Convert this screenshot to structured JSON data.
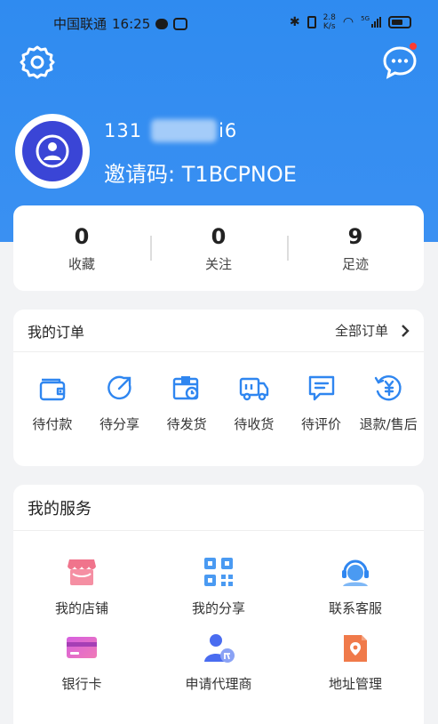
{
  "status_bar": {
    "carrier": "中国联通",
    "time": "16:25",
    "net_speed_value": "2.8",
    "net_speed_unit": "K/s",
    "signal_badge": "5G"
  },
  "header": {
    "settings_icon": "gear-icon",
    "messages_icon": "chat-bubble-icon",
    "notification_dot_color": "#ff3b30"
  },
  "profile": {
    "phone_prefix": "131",
    "phone_suffix": "i6",
    "invite_label": "邀请码: T1BCPNOE",
    "avatar_icon": "user-icon"
  },
  "stats": [
    {
      "value": "0",
      "label": "收藏"
    },
    {
      "value": "0",
      "label": "关注"
    },
    {
      "value": "9",
      "label": "足迹"
    }
  ],
  "orders": {
    "title": "我的订单",
    "all_label": "全部订单",
    "items": [
      {
        "label": "待付款",
        "icon": "wallet-icon"
      },
      {
        "label": "待分享",
        "icon": "share-arrow-icon"
      },
      {
        "label": "待发货",
        "icon": "package-clock-icon"
      },
      {
        "label": "待收货",
        "icon": "truck-icon"
      },
      {
        "label": "待评价",
        "icon": "comment-icon"
      },
      {
        "label": "退款/售后",
        "icon": "refund-yen-icon"
      }
    ]
  },
  "services": {
    "title": "我的服务",
    "items": [
      {
        "label": "我的店铺",
        "icon": "store-icon"
      },
      {
        "label": "我的分享",
        "icon": "qr-code-icon"
      },
      {
        "label": "联系客服",
        "icon": "customer-service-icon"
      },
      {
        "label": "银行卡",
        "icon": "bank-card-icon"
      },
      {
        "label": "申请代理商",
        "icon": "agent-icon"
      },
      {
        "label": "地址管理",
        "icon": "address-pin-icon"
      }
    ]
  },
  "colors": {
    "header_blue": "#3a90f2",
    "accent_blue": "#2f86f0",
    "avatar_navy": "#3a45d6"
  }
}
